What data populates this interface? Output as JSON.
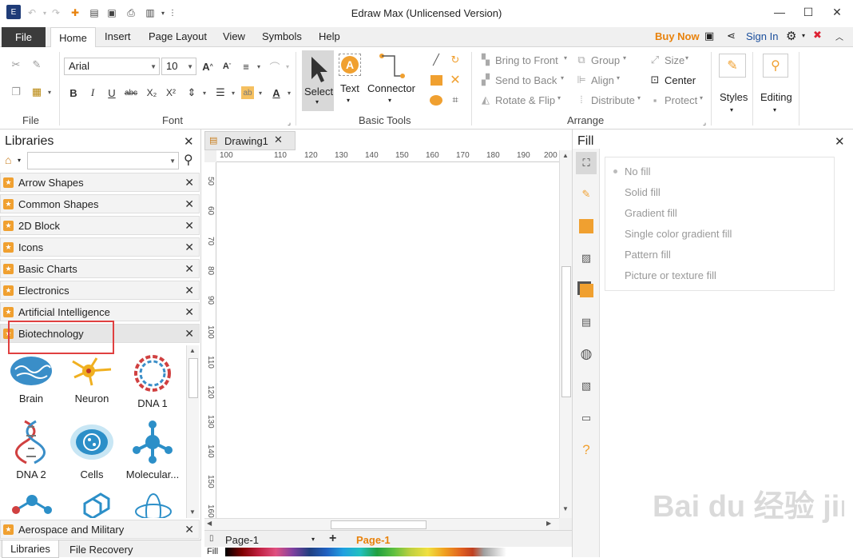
{
  "window": {
    "title": "Edraw Max (Unlicensed Version)",
    "minimize": "—",
    "maximize": "☐",
    "close": "✕"
  },
  "menu": {
    "tabs": [
      "File",
      "Home",
      "Insert",
      "Page Layout",
      "View",
      "Symbols",
      "Help"
    ],
    "buy_now": "Buy Now",
    "sign_in": "Sign In",
    "accent": "#e8820c"
  },
  "ribbon": {
    "groups": {
      "file": "File",
      "font": "Font",
      "basic_tools": "Basic Tools",
      "arrange": "Arrange"
    },
    "font_name": "Arial",
    "font_size": "10",
    "tools": {
      "select": "Select",
      "text": "Text",
      "connector": "Connector"
    },
    "arrange": {
      "bring_to_front": "Bring to Front",
      "send_to_back": "Send to Back",
      "rotate_flip": "Rotate & Flip",
      "group": "Group",
      "align": "Align",
      "distribute": "Distribute",
      "size": "Size",
      "center": "Center",
      "protect": "Protect"
    },
    "styles": "Styles",
    "editing": "Editing"
  },
  "libraries": {
    "title": "Libraries",
    "search_value": "",
    "items": [
      "Arrow Shapes",
      "Common Shapes",
      "2D Block",
      "Icons",
      "Basic Charts",
      "Electronics",
      "Artificial Intelligence",
      "Biotechnology"
    ],
    "shapes": [
      "Brain",
      "Neuron",
      "DNA 1",
      "DNA 2",
      "Cells",
      "Molecular..."
    ],
    "bottom_item": "Aerospace and Military",
    "bottom_tabs": [
      "Libraries",
      "File Recovery"
    ]
  },
  "document": {
    "tab": "Drawing1",
    "ruler_h": [
      "100",
      "110",
      "120",
      "130",
      "140",
      "150",
      "160",
      "170",
      "180",
      "190",
      "200"
    ],
    "ruler_v": [
      "50",
      "60",
      "70",
      "80",
      "90",
      "100",
      "110",
      "120",
      "130",
      "140",
      "150",
      "160"
    ],
    "page_selector": "Page-1",
    "page_tab": "Page-1",
    "add_page": "+",
    "fill_label": "Fill"
  },
  "fill_panel": {
    "title": "Fill",
    "options": [
      "No fill",
      "Solid fill",
      "Gradient fill",
      "Single color gradient fill",
      "Pattern fill",
      "Picture or texture fill"
    ]
  },
  "watermark": "Bai du 经验 jingyan.baidu.com"
}
